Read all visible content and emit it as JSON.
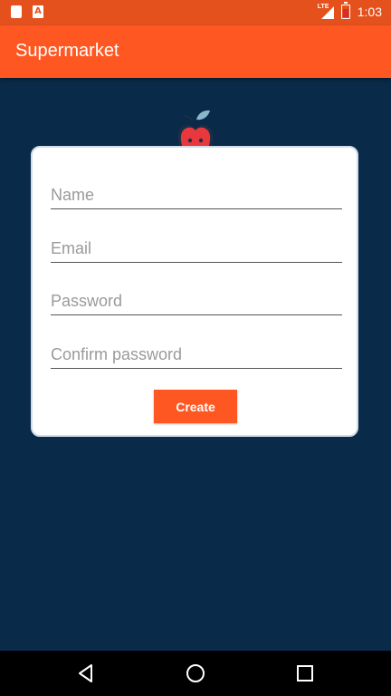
{
  "status_bar": {
    "time": "1:03",
    "network": "LTE",
    "left_icons": [
      "sd-card-icon",
      "a-notification-icon"
    ],
    "notification_letter": "A"
  },
  "app_bar": {
    "title": "Supermarket",
    "color": "#ff5722"
  },
  "logo": {
    "icon": "apple-mascot-icon"
  },
  "form": {
    "name_placeholder": "Name",
    "email_placeholder": "Email",
    "password_placeholder": "Password",
    "confirm_placeholder": "Confirm password",
    "create_label": "Create"
  },
  "nav_bar": {
    "buttons": [
      "back-icon",
      "home-icon",
      "recents-icon"
    ]
  },
  "colors": {
    "background": "#0a2a4a",
    "accent": "#ff5722",
    "status_bar": "#e4511d"
  }
}
